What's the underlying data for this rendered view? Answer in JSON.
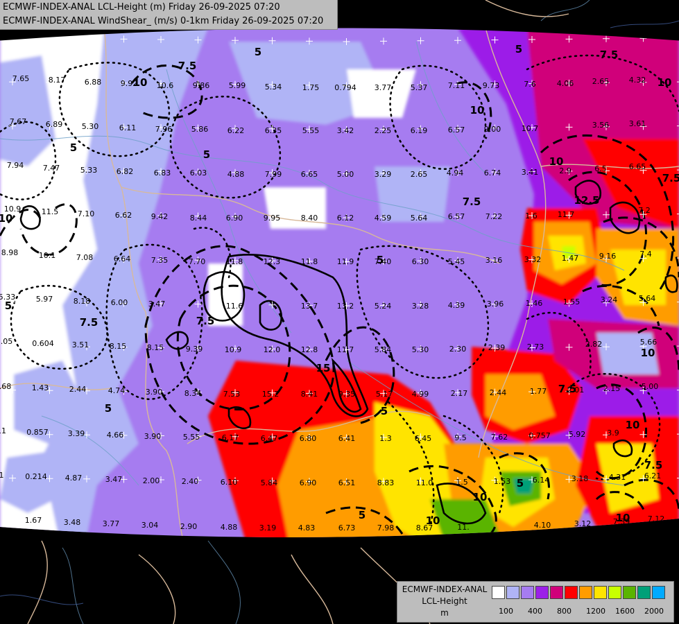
{
  "header": {
    "line1": "ECMWF-INDEX-ANAL LCL-Height (m) Friday 26-09-2025 07:20",
    "line2": "ECMWF-INDEX-ANAL WindShear_ (m/s) 0-1km Friday 26-09-2025 07:20"
  },
  "legend": {
    "title1": "ECMWF-INDEX-ANAL",
    "title2": "LCL-Height",
    "title3": "m",
    "colors": [
      "#ffffff",
      "#b0b4f6",
      "#a67cf0",
      "#9c1fe8",
      "#d0007a",
      "#ff0000",
      "#ff9c00",
      "#ffe400",
      "#c8ff00",
      "#5ab400",
      "#00a078",
      "#00aaff"
    ],
    "ticks": [
      "100",
      "400",
      "800",
      "1200",
      "1600",
      "2000"
    ]
  },
  "colors": {
    "background": "#000000",
    "border_lines": "#d8b99a",
    "river_lines": "#6fa0c8"
  },
  "wind_labels": [
    [
      "7.65",
      30,
      117
    ],
    [
      "8.17",
      82,
      119
    ],
    [
      "6.88",
      134,
      122
    ],
    [
      "9.92",
      186,
      124
    ],
    [
      "10.6",
      238,
      127
    ],
    [
      "9.86",
      290,
      127
    ],
    [
      "5.99",
      342,
      127
    ],
    [
      "5.34",
      394,
      129
    ],
    [
      "1.75",
      448,
      130
    ],
    [
      "0.794",
      498,
      130
    ],
    [
      "3.77",
      552,
      130
    ],
    [
      "5.37",
      604,
      130
    ],
    [
      "7.11",
      658,
      127
    ],
    [
      "9.73",
      708,
      127
    ],
    [
      "7.6",
      764,
      125
    ],
    [
      "4.06",
      815,
      124
    ],
    [
      "2.65",
      866,
      121
    ],
    [
      "4.32",
      919,
      119
    ],
    [
      "7.67",
      26,
      179
    ],
    [
      "6.89",
      78,
      183
    ],
    [
      "5.30",
      130,
      186
    ],
    [
      "6.11",
      184,
      188
    ],
    [
      "7.96",
      236,
      190
    ],
    [
      "5.86",
      288,
      190
    ],
    [
      "6.22",
      340,
      192
    ],
    [
      "6.35",
      394,
      192
    ],
    [
      "5.55",
      448,
      192
    ],
    [
      "3.42",
      498,
      192
    ],
    [
      "2.25",
      552,
      192
    ],
    [
      "6.19",
      604,
      192
    ],
    [
      "6.57",
      658,
      191
    ],
    [
      "9.00",
      710,
      190
    ],
    [
      "10.7",
      764,
      189
    ],
    [
      "3.56",
      866,
      184
    ],
    [
      "3.61",
      919,
      182
    ],
    [
      "7.94",
      22,
      242
    ],
    [
      "7.47",
      74,
      246
    ],
    [
      "5.33",
      128,
      249
    ],
    [
      "6.82",
      180,
      251
    ],
    [
      "6.83",
      234,
      253
    ],
    [
      "6.03",
      286,
      253
    ],
    [
      "4.88",
      340,
      255
    ],
    [
      "7.99",
      394,
      255
    ],
    [
      "6.65",
      446,
      255
    ],
    [
      "5.00",
      498,
      255
    ],
    [
      "3.29",
      552,
      255
    ],
    [
      "2.65",
      604,
      255
    ],
    [
      "4.94",
      656,
      253
    ],
    [
      "6.74",
      710,
      253
    ],
    [
      "3.41",
      764,
      252
    ],
    [
      "2.9",
      815,
      250
    ],
    [
      "6.5",
      866,
      247
    ],
    [
      "6.65",
      919,
      244
    ],
    [
      "10.9",
      18,
      305
    ],
    [
      "11.5",
      72,
      309
    ],
    [
      "7.10",
      124,
      312
    ],
    [
      "6.62",
      178,
      314
    ],
    [
      "9.42",
      230,
      316
    ],
    [
      "8.44",
      286,
      318
    ],
    [
      "6.90",
      338,
      318
    ],
    [
      "9.95",
      392,
      318
    ],
    [
      "8.40",
      446,
      318
    ],
    [
      "6.12",
      498,
      318
    ],
    [
      "4.59",
      552,
      318
    ],
    [
      "5.64",
      604,
      318
    ],
    [
      "6.57",
      658,
      316
    ],
    [
      "7.22",
      712,
      316
    ],
    [
      "1.6",
      766,
      315
    ],
    [
      "11.7",
      816,
      313
    ],
    [
      "7.2",
      929,
      307
    ],
    [
      "8.98",
      14,
      368
    ],
    [
      "10.1",
      68,
      372
    ],
    [
      "7.08",
      122,
      375
    ],
    [
      "6.64",
      176,
      377
    ],
    [
      "7.35",
      230,
      379
    ],
    [
      "7.70",
      284,
      381
    ],
    [
      "11.8",
      338,
      381
    ],
    [
      "12.3",
      392,
      381
    ],
    [
      "11.8",
      446,
      381
    ],
    [
      "11.9",
      498,
      381
    ],
    [
      "7.40",
      552,
      381
    ],
    [
      "6.30",
      606,
      381
    ],
    [
      "5.45",
      658,
      381
    ],
    [
      "3.16",
      712,
      379
    ],
    [
      "3.32",
      768,
      378
    ],
    [
      "1.47",
      822,
      376
    ],
    [
      "9.16",
      876,
      373
    ],
    [
      "7.4",
      931,
      370
    ],
    [
      "5.33",
      10,
      432
    ],
    [
      "5.97",
      64,
      435
    ],
    [
      "8.18",
      118,
      438
    ],
    [
      "6.00",
      172,
      440
    ],
    [
      "3.47",
      226,
      442
    ],
    [
      "11.6",
      338,
      445
    ],
    [
      "13.7",
      446,
      445
    ],
    [
      "13.2",
      498,
      445
    ],
    [
      "5.24",
      552,
      445
    ],
    [
      "3.28",
      606,
      445
    ],
    [
      "4.39",
      658,
      444
    ],
    [
      "3.96",
      714,
      442
    ],
    [
      "1.46",
      770,
      441
    ],
    [
      "1.55",
      824,
      439
    ],
    [
      "3.24",
      878,
      436
    ],
    [
      "5.64",
      933,
      434
    ],
    [
      "1.05",
      6,
      496
    ],
    [
      "0.604",
      62,
      499
    ],
    [
      "3.51",
      116,
      501
    ],
    [
      "8.15",
      170,
      503
    ],
    [
      "8.15",
      224,
      505
    ],
    [
      "9.39",
      280,
      507
    ],
    [
      "10.9",
      336,
      508
    ],
    [
      "12.0",
      392,
      508
    ],
    [
      "12.8",
      446,
      508
    ],
    [
      "11.7",
      498,
      508
    ],
    [
      "5.84",
      552,
      508
    ],
    [
      "5.30",
      606,
      508
    ],
    [
      "2.30",
      660,
      507
    ],
    [
      "2.39",
      716,
      505
    ],
    [
      "2.73",
      772,
      504
    ],
    [
      "2.82",
      856,
      500
    ],
    [
      "5.66",
      935,
      497
    ],
    [
      "1.68",
      4,
      561
    ],
    [
      "1.43",
      58,
      563
    ],
    [
      "2.44",
      112,
      565
    ],
    [
      "4.74",
      168,
      567
    ],
    [
      "3.90",
      222,
      569
    ],
    [
      "8.34",
      278,
      571
    ],
    [
      "7.53",
      334,
      572
    ],
    [
      "15.2",
      390,
      572
    ],
    [
      "8.41",
      446,
      572
    ],
    [
      "9.35",
      500,
      572
    ],
    [
      "5.17",
      554,
      572
    ],
    [
      "4.99",
      606,
      572
    ],
    [
      "2.17",
      662,
      571
    ],
    [
      "2.44",
      718,
      570
    ],
    [
      "1.77",
      776,
      568
    ],
    [
      "2.01",
      830,
      566
    ],
    [
      "2.15",
      882,
      564
    ],
    [
      "5.00",
      937,
      561
    ],
    [
      "11",
      2,
      625
    ],
    [
      "0.857",
      54,
      627
    ],
    [
      "3.39",
      110,
      629
    ],
    [
      "4.66",
      166,
      631
    ],
    [
      "3.90",
      220,
      633
    ],
    [
      "5.55",
      276,
      634
    ],
    [
      "6.17",
      332,
      635
    ],
    [
      "6.47",
      388,
      636
    ],
    [
      "6.80",
      444,
      636
    ],
    [
      "6.41",
      500,
      636
    ],
    [
      "1.3",
      556,
      636
    ],
    [
      "6.45",
      610,
      636
    ],
    [
      "9.5",
      664,
      635
    ],
    [
      "7.62",
      720,
      634
    ],
    [
      "0.757",
      778,
      632
    ],
    [
      "5.92",
      832,
      630
    ],
    [
      "3.9",
      884,
      628
    ],
    [
      "1",
      2,
      689
    ],
    [
      "0.214",
      52,
      691
    ],
    [
      "4.87",
      106,
      693
    ],
    [
      "3.47",
      164,
      695
    ],
    [
      "2.00",
      218,
      697
    ],
    [
      "2.40",
      274,
      698
    ],
    [
      "6.10",
      330,
      699
    ],
    [
      "5.84",
      388,
      700
    ],
    [
      "6.90",
      444,
      700
    ],
    [
      "6.51",
      500,
      700
    ],
    [
      "8.83",
      556,
      700
    ],
    [
      "11.0",
      612,
      700
    ],
    [
      "1.5",
      666,
      699
    ],
    [
      "1.53",
      724,
      698
    ],
    [
      "6.14",
      780,
      696
    ],
    [
      "3.18",
      836,
      694
    ],
    [
      "4.31",
      890,
      692
    ],
    [
      "6.21",
      941,
      690
    ],
    [
      "1.67",
      48,
      754
    ],
    [
      "3.48",
      104,
      757
    ],
    [
      "3.77",
      160,
      759
    ],
    [
      "3.04",
      216,
      761
    ],
    [
      "2.90",
      272,
      763
    ],
    [
      "4.88",
      330,
      764
    ],
    [
      "3.19",
      386,
      765
    ],
    [
      "4.83",
      442,
      765
    ],
    [
      "6.73",
      500,
      765
    ],
    [
      "7.98",
      556,
      765
    ],
    [
      "8.67",
      612,
      765
    ],
    [
      "11.",
      668,
      764
    ],
    [
      "4.10",
      782,
      761
    ],
    [
      "3.12",
      840,
      759
    ],
    [
      "7.39",
      896,
      756
    ],
    [
      "7.12",
      946,
      752
    ]
  ],
  "contour_labels": [
    [
      "7.5",
      270,
      100
    ],
    [
      "5",
      372,
      80
    ],
    [
      "5",
      748,
      76
    ],
    [
      "7.5",
      878,
      84
    ],
    [
      "10",
      958,
      124
    ],
    [
      "10",
      202,
      124
    ],
    [
      "5",
      106,
      218
    ],
    [
      "5",
      298,
      228
    ],
    [
      "10",
      688,
      164
    ],
    [
      "7.5",
      968,
      262
    ],
    [
      "10",
      8,
      320
    ],
    [
      "12.5",
      846,
      294
    ],
    [
      "5",
      548,
      380
    ],
    [
      "7.5",
      680,
      296
    ],
    [
      "10",
      802,
      238
    ],
    [
      "7.5",
      128,
      470
    ],
    [
      "7.5",
      296,
      468
    ],
    [
      "5",
      12,
      446
    ],
    [
      "5",
      156,
      594
    ],
    [
      "15",
      466,
      536
    ],
    [
      "5",
      554,
      598
    ],
    [
      "10",
      692,
      722
    ],
    [
      "10",
      624,
      756
    ],
    [
      "5",
      522,
      748
    ],
    [
      "5",
      750,
      702
    ],
    [
      "10",
      934,
      514
    ],
    [
      "10",
      912,
      618
    ],
    [
      "7.5",
      942,
      676
    ],
    [
      "10",
      898,
      752
    ],
    [
      "7.5",
      818,
      566
    ]
  ]
}
